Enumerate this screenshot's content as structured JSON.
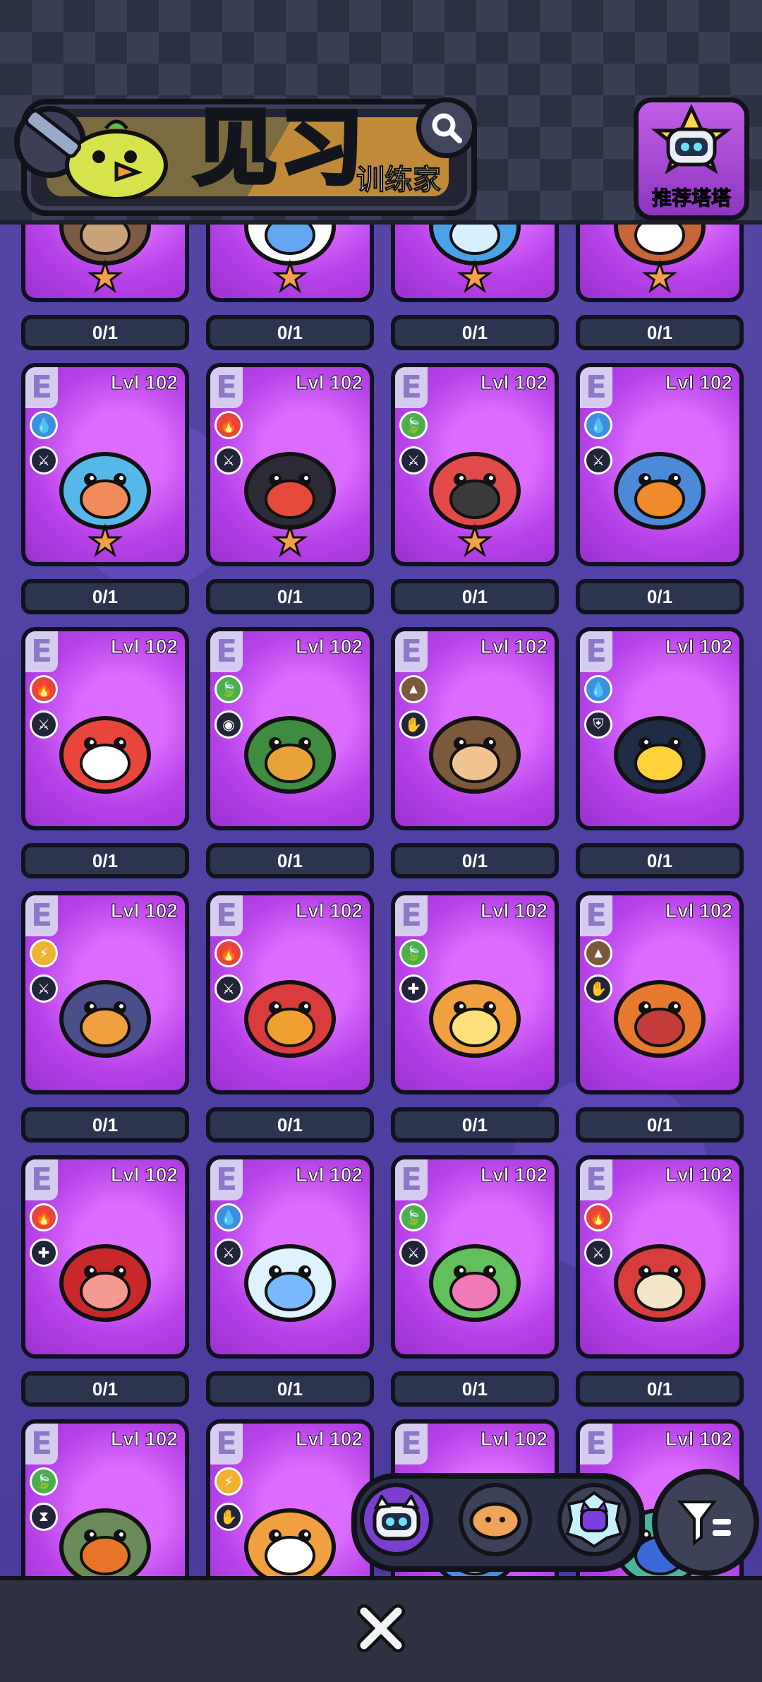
{
  "header": {
    "title_main": "见习",
    "title_sub": "训练家",
    "recommend_label": "推荐塔塔"
  },
  "colors": {
    "fire": "#e8433c",
    "water": "#3f8fe0",
    "grass": "#4cae4c",
    "electric": "#f0b32e",
    "earth": "#7a5a3a",
    "card_purple": "#b743e8"
  },
  "cards": [
    {
      "rarity": "",
      "level": "",
      "element": "",
      "role": "",
      "count": "0/1",
      "star": true
    },
    {
      "rarity": "",
      "level": "",
      "element": "",
      "role": "",
      "count": "0/1",
      "star": true
    },
    {
      "rarity": "",
      "level": "",
      "element": "",
      "role": "",
      "count": "0/1",
      "star": true
    },
    {
      "rarity": "",
      "level": "",
      "element": "",
      "role": "",
      "count": "0/1",
      "star": true
    },
    {
      "rarity": "E",
      "level": "Lvl 102",
      "element": "water",
      "role": "attack",
      "count": "0/1",
      "star": true
    },
    {
      "rarity": "E",
      "level": "Lvl 102",
      "element": "fire",
      "role": "attack",
      "count": "0/1",
      "star": true
    },
    {
      "rarity": "E",
      "level": "Lvl 102",
      "element": "grass",
      "role": "attack",
      "count": "0/1",
      "star": true
    },
    {
      "rarity": "E",
      "level": "Lvl 102",
      "element": "water",
      "role": "attack",
      "count": "0/1",
      "star": false
    },
    {
      "rarity": "E",
      "level": "Lvl 102",
      "element": "fire",
      "role": "attack",
      "count": "0/1",
      "star": false
    },
    {
      "rarity": "E",
      "level": "Lvl 102",
      "element": "grass",
      "role": "eye",
      "count": "0/1",
      "star": false
    },
    {
      "rarity": "E",
      "level": "Lvl 102",
      "element": "earth",
      "role": "support",
      "count": "0/1",
      "star": false
    },
    {
      "rarity": "E",
      "level": "Lvl 102",
      "element": "water",
      "role": "defense",
      "count": "0/1",
      "star": false
    },
    {
      "rarity": "E",
      "level": "Lvl 102",
      "element": "electric",
      "role": "attack",
      "count": "0/1",
      "star": false
    },
    {
      "rarity": "E",
      "level": "Lvl 102",
      "element": "fire",
      "role": "attack",
      "count": "0/1",
      "star": false
    },
    {
      "rarity": "E",
      "level": "Lvl 102",
      "element": "grass",
      "role": "heal",
      "count": "0/1",
      "star": false
    },
    {
      "rarity": "E",
      "level": "Lvl 102",
      "element": "earth",
      "role": "support",
      "count": "0/1",
      "star": false
    },
    {
      "rarity": "E",
      "level": "Lvl 102",
      "element": "fire",
      "role": "heal",
      "count": "0/1",
      "star": false
    },
    {
      "rarity": "E",
      "level": "Lvl 102",
      "element": "water",
      "role": "attack",
      "count": "0/1",
      "star": false
    },
    {
      "rarity": "E",
      "level": "Lvl 102",
      "element": "grass",
      "role": "attack",
      "count": "0/1",
      "star": false
    },
    {
      "rarity": "E",
      "level": "Lvl 102",
      "element": "fire",
      "role": "attack",
      "count": "0/1",
      "star": false
    },
    {
      "rarity": "E",
      "level": "Lvl 102",
      "element": "grass",
      "role": "time",
      "count": "",
      "star": false
    },
    {
      "rarity": "E",
      "level": "Lvl 102",
      "element": "electric",
      "role": "support",
      "count": "",
      "star": false
    },
    {
      "rarity": "E",
      "level": "Lvl 102",
      "element": "",
      "role": "",
      "count": "",
      "star": false
    },
    {
      "rarity": "E",
      "level": "Lvl 102",
      "element": "",
      "role": "",
      "count": "",
      "star": false
    }
  ],
  "filters": [
    "blue-cat-filter",
    "bread-filter",
    "purple-cat-filter"
  ],
  "icons": {
    "search": "search-icon",
    "filter": "filter-icon",
    "close": "close-icon"
  }
}
